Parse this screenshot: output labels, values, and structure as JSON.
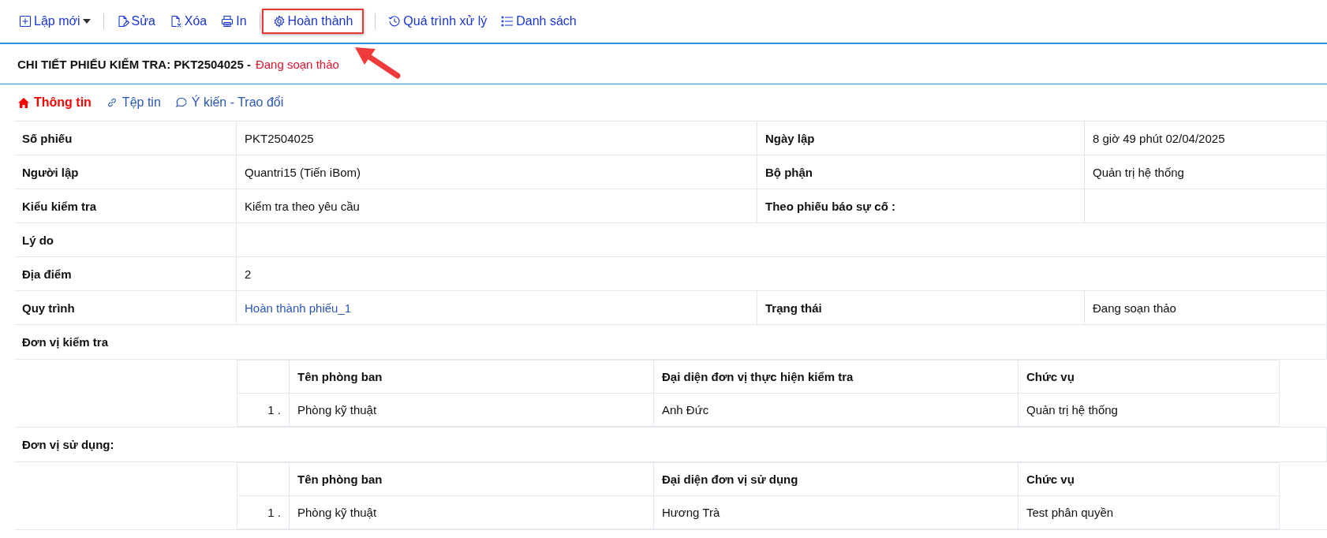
{
  "toolbar": {
    "groups": [
      [
        {
          "label": "Lập mới",
          "dropdown": true,
          "highlighted": false
        }
      ],
      [
        {
          "label": "Sửa",
          "dropdown": false,
          "highlighted": false
        },
        {
          "label": "Xóa",
          "dropdown": false,
          "highlighted": false
        },
        {
          "label": "In",
          "dropdown": false,
          "highlighted": false
        }
      ],
      [
        {
          "label": "Hoàn thành",
          "dropdown": false,
          "highlighted": true
        }
      ],
      [
        {
          "label": "Quá trình xử lý",
          "dropdown": false,
          "highlighted": false
        },
        {
          "label": "Danh sách",
          "dropdown": false,
          "highlighted": false
        }
      ]
    ]
  },
  "header": {
    "title": "CHI TIẾT PHIẾU KIỂM TRA: PKT2504025 -",
    "status": "Đang soạn thảo"
  },
  "tabs": [
    {
      "label": "Thông tin",
      "selected": true
    },
    {
      "label": "Tệp tin",
      "selected": false
    },
    {
      "label": "Ý kiến - Trao đổi",
      "selected": false
    }
  ],
  "rows": [
    {
      "kind": "pair",
      "label": "Số phiếu",
      "value": "PKT2504025",
      "label_2": "Ngày lập",
      "value_2": "8 giờ 49 phút 02/04/2025"
    },
    {
      "kind": "pair",
      "label": "Người lập",
      "value": "Quantri15 (Tiến iBom)",
      "label_2": "Bộ phận",
      "value_2": "Quản trị hệ thống"
    },
    {
      "kind": "pair",
      "label": "Kiểu kiểm tra",
      "value": "Kiểm tra theo yêu cầu",
      "label_2": "Theo phiếu báo sự cố :"
    },
    {
      "kind": "wide",
      "label": "Lý do"
    },
    {
      "kind": "wide",
      "label": "Địa điểm",
      "value": "2"
    },
    {
      "kind": "pair",
      "label": "Quy trình",
      "value": "Hoàn thành phiếu_1",
      "link": true,
      "label_2": "Trạng thái",
      "value_2": "Đang soạn thảo"
    },
    {
      "kind": "section",
      "label": "Đơn vị kiểm tra",
      "columns": [
        "Tên phòng ban",
        "Đại diện đơn vị thực hiện kiểm tra",
        "Chức vụ"
      ],
      "items": [
        [
          "1 .",
          "Phòng kỹ thuật",
          "Anh Đức",
          "Quản trị hệ thống"
        ]
      ]
    },
    {
      "kind": "section",
      "label": "Đơn vị sử dụng:",
      "columns": [
        "Tên phòng ban",
        "Đại diện đơn vị sử dụng",
        "Chức vụ"
      ],
      "items": [
        [
          "1 .",
          "Phòng kỹ thuật",
          "Hương Trà",
          "Test phân quyền"
        ]
      ]
    }
  ]
}
